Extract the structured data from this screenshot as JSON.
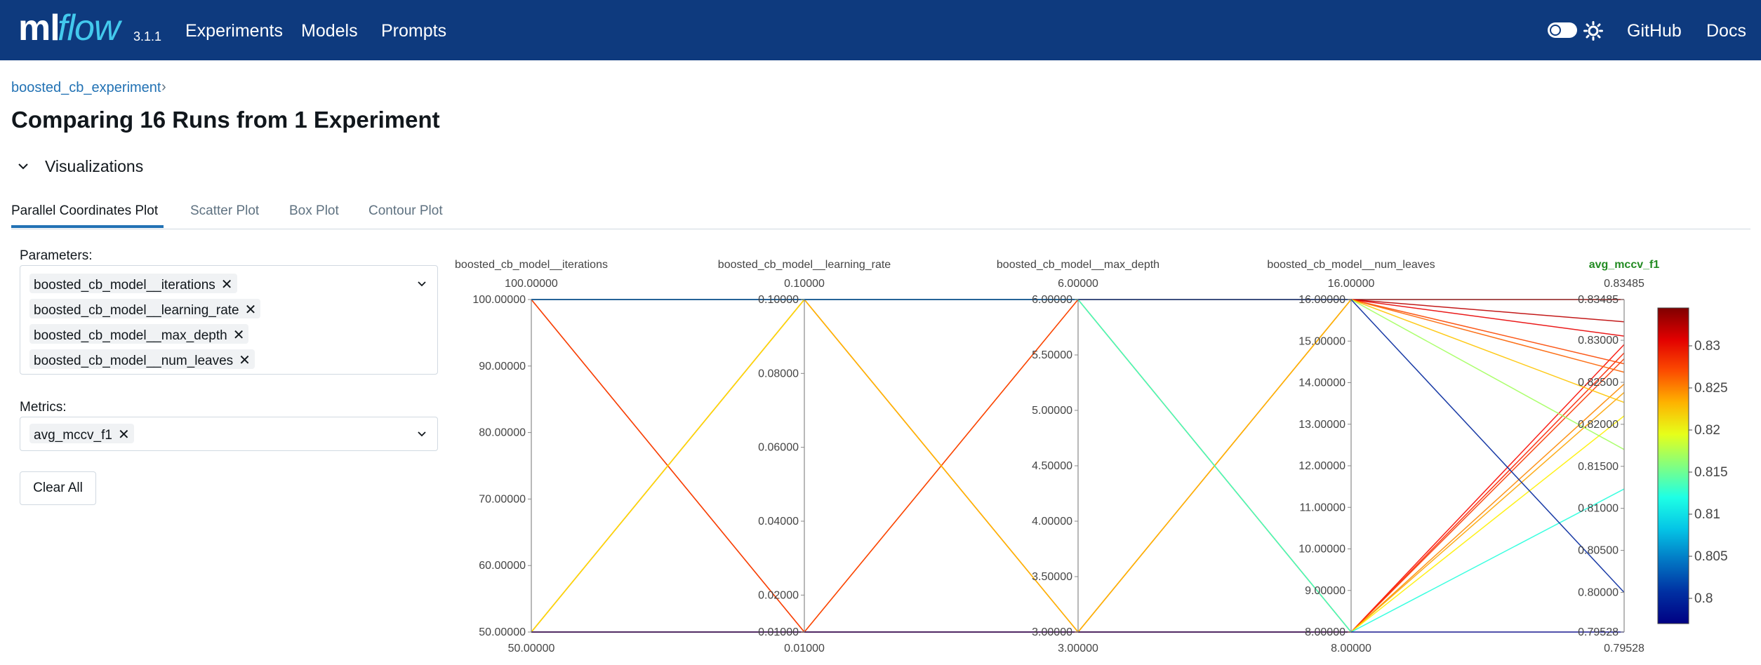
{
  "header": {
    "logo_ml": "ml",
    "logo_flow": "flow",
    "version": "3.1.1",
    "nav": [
      "Experiments",
      "Models",
      "Prompts"
    ],
    "right_links": [
      "GitHub",
      "Docs"
    ],
    "icons": {
      "toggle": "theme-toggle",
      "sun": "sun-icon"
    }
  },
  "breadcrumb": {
    "experiment": "boosted_cb_experiment",
    "separator": "›"
  },
  "page": {
    "title": "Comparing 16 Runs from 1 Experiment"
  },
  "section": {
    "label": "Visualizations"
  },
  "tabs": [
    "Parallel Coordinates Plot",
    "Scatter Plot",
    "Box Plot",
    "Contour Plot"
  ],
  "active_tab": "Parallel Coordinates Plot",
  "params": {
    "label": "Parameters:",
    "selected": [
      "boosted_cb_model__iterations",
      "boosted_cb_model__learning_rate",
      "boosted_cb_model__max_depth",
      "boosted_cb_model__num_leaves"
    ]
  },
  "metrics": {
    "label": "Metrics:",
    "selected": [
      "avg_mccv_f1"
    ]
  },
  "clear_label": "Clear All",
  "colors": {
    "brand": "#0e3a7e",
    "accent": "#2272b4",
    "logo_flow": "#43c9ed",
    "metric_axis": "#228b22"
  },
  "chart_data": {
    "type": "parallel_coordinates",
    "colorscale": "jet",
    "color_metric": "avg_mccv_f1",
    "colorbar_ticks": [
      "0.8",
      "0.805",
      "0.81",
      "0.815",
      "0.82",
      "0.825",
      "0.83"
    ],
    "axes": [
      {
        "name": "boosted_cb_model__iterations",
        "range": [
          50,
          100
        ],
        "top_label": "100.00000",
        "bottom_label": "50.00000",
        "ticks": [
          "90.00000",
          "80.00000",
          "70.00000",
          "60.00000"
        ],
        "tick_values": [
          90,
          80,
          70,
          60
        ]
      },
      {
        "name": "boosted_cb_model__learning_rate",
        "range": [
          0.01,
          0.1
        ],
        "top_label": "0.10000",
        "bottom_label": "0.01000",
        "ticks": [
          "0.08000",
          "0.06000",
          "0.04000",
          "0.02000"
        ],
        "tick_values": [
          0.08,
          0.06,
          0.04,
          0.02
        ]
      },
      {
        "name": "boosted_cb_model__max_depth",
        "range": [
          3,
          6
        ],
        "top_label": "6.00000",
        "bottom_label": "3.00000",
        "ticks": [
          "5.50000",
          "5.00000",
          "4.50000",
          "4.00000",
          "3.50000"
        ],
        "tick_values": [
          5.5,
          5.0,
          4.5,
          4.0,
          3.5
        ]
      },
      {
        "name": "boosted_cb_model__num_leaves",
        "range": [
          8,
          16
        ],
        "top_label": "16.00000",
        "bottom_label": "8.00000",
        "ticks": [
          "15.00000",
          "14.00000",
          "13.00000",
          "12.00000",
          "11.00000",
          "10.00000",
          "9.00000"
        ],
        "tick_values": [
          15,
          14,
          13,
          12,
          11,
          10,
          9
        ]
      },
      {
        "name": "avg_mccv_f1",
        "range": [
          0.79528,
          0.83485
        ],
        "top_label": "0.83485",
        "bottom_label": "0.79528",
        "ticks": [
          "0.83000",
          "0.82500",
          "0.82000",
          "0.81500",
          "0.81000",
          "0.80500",
          "0.80000"
        ],
        "tick_values": [
          0.83,
          0.825,
          0.82,
          0.815,
          0.81,
          0.805,
          0.8
        ],
        "is_metric": true
      }
    ],
    "runs": [
      [
        100,
        0.1,
        6,
        16,
        0.83485
      ],
      [
        50,
        0.1,
        6,
        16,
        0.8322
      ],
      [
        100,
        0.01,
        3,
        16,
        0.8305
      ],
      [
        50,
        0.01,
        3,
        8,
        0.8295
      ],
      [
        100,
        0.1,
        3,
        8,
        0.8285
      ],
      [
        50,
        0.01,
        6,
        8,
        0.8278
      ],
      [
        100,
        0.01,
        6,
        16,
        0.8272
      ],
      [
        50,
        0.1,
        3,
        16,
        0.8262
      ],
      [
        100,
        0.1,
        6,
        8,
        0.8248
      ],
      [
        50,
        0.01,
        3,
        8,
        0.8238
      ],
      [
        100,
        0.1,
        3,
        16,
        0.8226
      ],
      [
        50,
        0.1,
        6,
        8,
        0.821
      ],
      [
        100,
        0.1,
        6,
        16,
        0.817
      ],
      [
        100,
        0.1,
        6,
        8,
        0.8123
      ],
      [
        100,
        0.1,
        6,
        16,
        0.8
      ],
      [
        50,
        0.01,
        3,
        8,
        0.79528
      ]
    ]
  }
}
